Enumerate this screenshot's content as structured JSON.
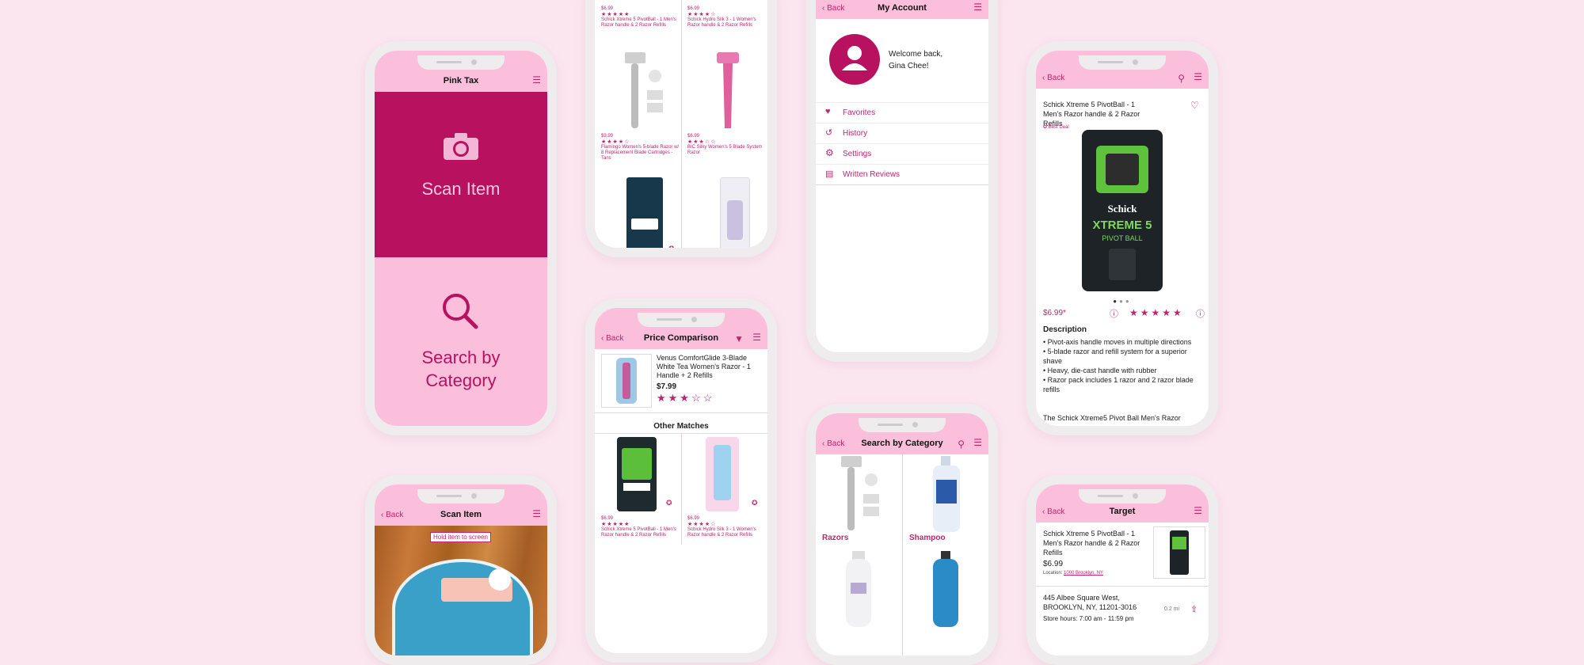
{
  "home": {
    "title": "Pink Tax",
    "scan_label": "Scan Item",
    "search_label": "Search by Category",
    "icon_camera": "camera-icon",
    "icon_search": "magnifier-icon"
  },
  "scan": {
    "back": "Back",
    "title": "Scan Item",
    "hint": "Hold item to screen"
  },
  "listing": {
    "items": [
      {
        "price": "$6.99",
        "stars": "★★★★★",
        "name": "Schick Xtreme 5 PivotBall - 1 Men's Razor handle & 2 Razor Refills"
      },
      {
        "price": "$6.99",
        "stars": "★★★★☆",
        "name": "Schick Hydro Silk 3 - 1 Women's Razor handle & 2 Razor Refills"
      },
      {
        "price": "$9.99",
        "stars": "★★★★☆",
        "name": "Flamingo Women's 5-blade Razor w/ 8 Replacement Blade Cartridges - Tans"
      },
      {
        "price": "$6.99",
        "stars": "★★★☆☆",
        "name": "BIC Silky Women's 5 Blade System Razor"
      }
    ]
  },
  "price_comparison": {
    "back": "Back",
    "title": "Price Comparison",
    "main_item": {
      "name": "Venus ComfortGlide 3-Blade White Tea Women's Razor - 1 Handle + 2 Refills",
      "price": "$7.99",
      "stars": "★★★☆☆"
    },
    "other_matches_label": "Other Matches",
    "matches": [
      {
        "price": "$6.99",
        "stars": "★★★★★",
        "name": "Schick Xtreme 5 PivotBall - 1 Men's Razor handle & 2 Razor Refills"
      },
      {
        "price": "$6.99",
        "stars": "★★★★☆",
        "name": "Schick Hydro Silk 3 - 1 Women's Razor handle & 2 Razor Refills"
      }
    ]
  },
  "account": {
    "back": "Back",
    "title": "My Account",
    "welcome_line1": "Welcome back,",
    "welcome_line2": "Gina Chee!",
    "menu": [
      {
        "label": "Favorites",
        "icon": "heart-icon"
      },
      {
        "label": "History",
        "icon": "history-icon"
      },
      {
        "label": "Settings",
        "icon": "gear-icon"
      },
      {
        "label": "Written Reviews",
        "icon": "reviews-icon"
      }
    ]
  },
  "category": {
    "back": "Back",
    "title": "Search by Category",
    "categories": [
      "Razors",
      "Shampoo"
    ]
  },
  "product": {
    "back": "Back",
    "name": "Schick Xtreme 5 PivotBall - 1 Men's Razor handle & 2 Razor Refills",
    "badge": "Best Deal",
    "price": "$6.99*",
    "stars": "★★★★★",
    "description_label": "Description",
    "bullets": [
      "• Pivot-axis handle moves in multiple directions",
      "• 5-blade razor and refill system for a superior shave",
      "• Heavy, die-cast handle with rubber",
      "• Razor pack includes 1 razor and 2 razor blade refills"
    ],
    "more_text": "The Schick Xtreme5 Pivot Ball Men's Razor",
    "package_brand": "Schick",
    "package_line1": "XTREME 5",
    "package_line2": "PIVOT BALL"
  },
  "store": {
    "back": "Back",
    "title": "Target",
    "item_name": "Schick Xtreme 5 PivotBall - 1 Men's Razor handle & 2 Razor Refills",
    "price": "$6.99",
    "location_label": "Location:",
    "location_value": "1000 Brooklyn, NY",
    "address_line1": "445 Albee Square West,",
    "address_line2": "BROOKLYN, NY, 11201-3016",
    "distance": "0.2 mi",
    "hours": "Store hours: 7:00 am - 11:59 pm"
  },
  "colors": {
    "accent": "#c0246f",
    "scan_panel": "#b8115f",
    "light_pink": "#fbbfdc",
    "background": "#fbe6ef"
  }
}
